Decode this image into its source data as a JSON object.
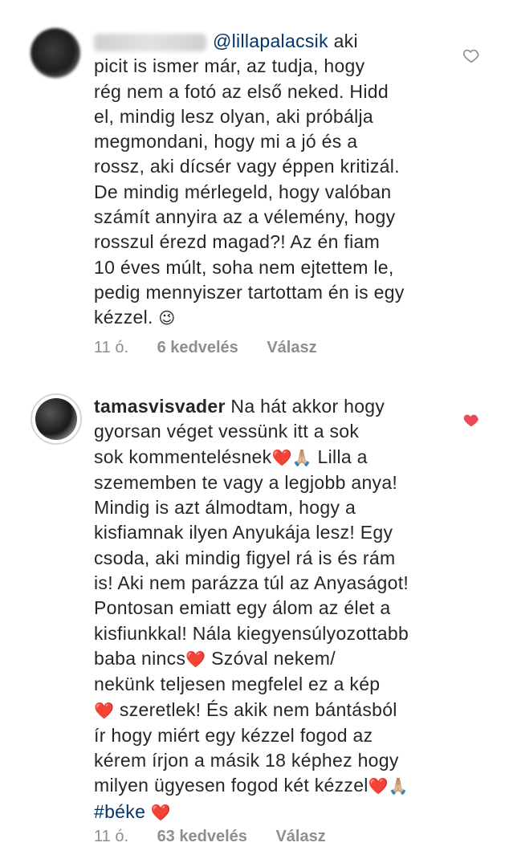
{
  "comments": [
    {
      "mention": "@lillapalacsik",
      "text_first": " aki",
      "text_rest": "picit is ismer már, az tudja, hogy\nrég nem a fotó az első neked. Hidd\nel, mindig lesz olyan, aki próbálja\nmegmondani, hogy mi a jó és a\nrossz, aki dícsér vagy éppen kritizál.\nDe mindig mérlegeld, hogy valóban\nszámít annyira az a vélemény, hogy\nrosszul érezd magad?! Az én fiam\n10 éves múlt, soha nem ejtettem le,\npedig mennyiszer tartottam én is egy\nkézzel. ",
      "emoji": "😉",
      "time": "11 ó.",
      "likes": "6 kedvelés",
      "reply": "Válasz",
      "liked": false
    },
    {
      "username": "tamasvisvader",
      "part1": " Na hát akkor hogy\ngyorsan véget vessünk itt a sok\nsok kommentelésnek",
      "emoji_a": "❤️🙏🏼",
      "part2": " Lilla a\nszememben te vagy a legjobb anya!\nMindig is azt álmodtam, hogy a\nkisfiamnak ilyen Anyukája lesz! Egy\ncsoda, aki mindig figyel rá is és rám\nis! Aki nem parázza túl az Anyaságot!\nPontosan emiatt egy álom az élet a\nkisfiunkkal! Nála kiegyensúlyozottabb\nbaba nincs",
      "emoji_b": "❤️",
      "part3": " Szóval nekem/\nnekünk teljesen megfelel ez a kép\n",
      "emoji_c": "❤️",
      "part4": " szeretlek! És akik nem bántásból\nír hogy miért egy kézzel fogod az\nkérem írjon a másik 18 képhez hogy\nmilyen ügyesen fogod két kézzel",
      "emoji_d": "❤️🙏🏼",
      "hashtag": "#béke",
      "emoji_e": "❤️",
      "time": "11 ó.",
      "likes": "63 kedvelés",
      "reply": "Válasz",
      "liked": true
    }
  ],
  "colors": {
    "text": "#262626",
    "link": "#003569",
    "meta": "#8e8e8e",
    "like_red": "#ed4956"
  }
}
